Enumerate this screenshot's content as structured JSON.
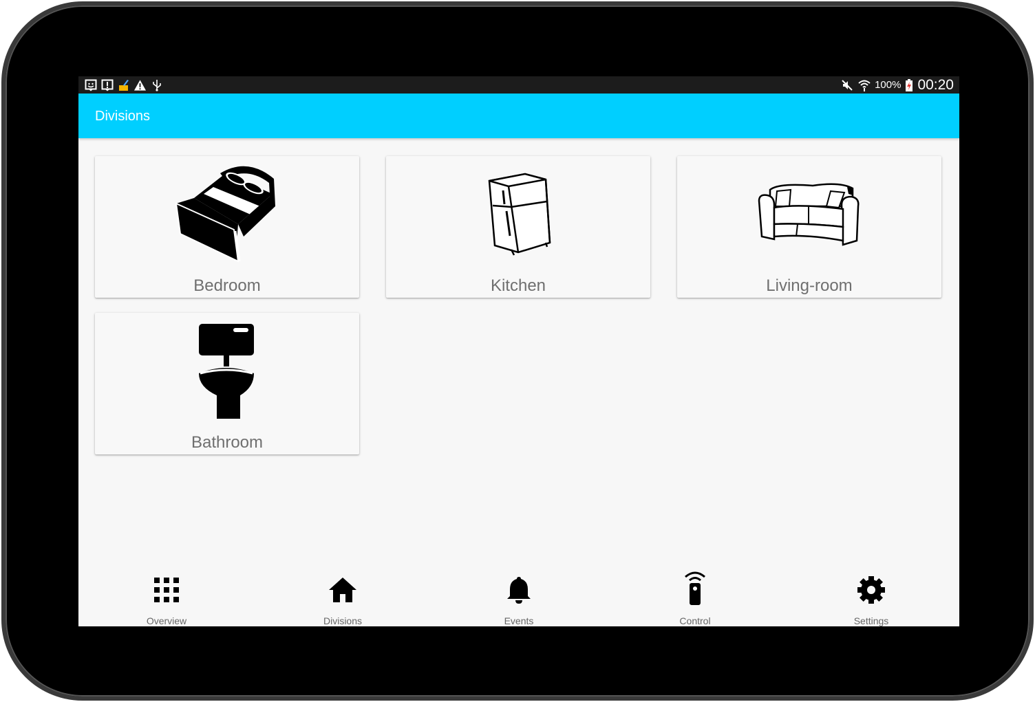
{
  "status_bar": {
    "left_icons": [
      "chat-icon",
      "alert-box-icon",
      "cleaner-icon",
      "warning-icon",
      "usb-icon"
    ],
    "right_icons": [
      "mute-icon",
      "wifi-icon",
      "battery-icon"
    ],
    "battery": "100%",
    "time": "00:20"
  },
  "app_bar": {
    "title": "Divisions"
  },
  "divisions": [
    {
      "label": "Bedroom",
      "icon": "bed-icon"
    },
    {
      "label": "Kitchen",
      "icon": "fridge-icon"
    },
    {
      "label": "Living-room",
      "icon": "sofa-icon"
    },
    {
      "label": "Bathroom",
      "icon": "toilet-icon"
    }
  ],
  "bottom_nav": [
    {
      "label": "Overview",
      "icon": "grid-icon"
    },
    {
      "label": "Divisions",
      "icon": "home-icon"
    },
    {
      "label": "Events",
      "icon": "bell-icon"
    },
    {
      "label": "Control",
      "icon": "remote-icon"
    },
    {
      "label": "Settings",
      "icon": "gear-icon"
    }
  ],
  "colors": {
    "app_bar": "#00cfff",
    "status_bar": "#1c1c1c",
    "background": "#f7f7f7"
  }
}
